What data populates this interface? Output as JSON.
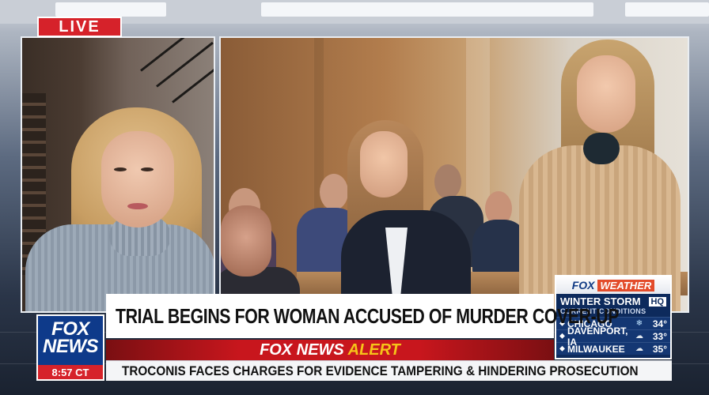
{
  "live_badge": "LIVE",
  "headline": "TRIAL BEGINS FOR WOMAN ACCUSED OF MURDER COVER-UP",
  "alert": {
    "brand": "FOX NEWS",
    "label": "ALERT"
  },
  "ticker": "TROCONIS FACES CHARGES FOR EVIDENCE TAMPERING & HINDERING PROSECUTION",
  "network_logo": {
    "line1": "FOX",
    "line2": "NEWS",
    "time": "8:57 CT"
  },
  "weather": {
    "brand_fox": "FOX",
    "brand_weather": "WEATHER",
    "title": "WINTER STORM",
    "title_badge": "HQ",
    "subtitle": "CURRENT CONDITIONS",
    "cities": [
      {
        "name": "CHICAGO",
        "temp": "34°",
        "icon": "snow-icon"
      },
      {
        "name": "DAVENPORT, IA",
        "temp": "33°",
        "icon": "cloud-icon"
      },
      {
        "name": "MILWAUKEE",
        "temp": "35°",
        "icon": "cloud-icon"
      }
    ]
  },
  "colors": {
    "live_red": "#d6222a",
    "fox_blue": "#0e3a8a",
    "alert_red": "#c8161d",
    "alert_yellow": "#f6c419",
    "weather_navy": "#0d2a5c"
  }
}
